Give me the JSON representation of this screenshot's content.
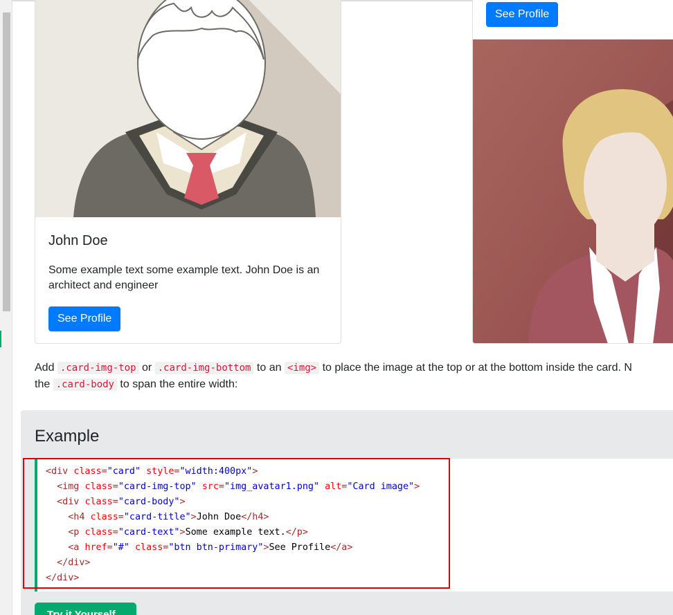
{
  "cards": [
    {
      "title": "John Doe",
      "text": "Some example text some example text. John Doe is an architect and engineer",
      "button_label": "See Profile"
    },
    {
      "button_label": "See Profile"
    }
  ],
  "description": {
    "part1": "Add ",
    "code1": ".card-img-top",
    "part2": " or ",
    "code2": ".card-img-bottom",
    "part3": " to an ",
    "code3": "<img>",
    "part4": " to place the image at the top or at the bottom inside the card. N",
    "line2_part1": "the ",
    "code4": ".card-body",
    "line2_part2": " to span the entire width:"
  },
  "example": {
    "title": "Example",
    "code_lines": [
      [
        [
          "t-tag",
          "<div "
        ],
        [
          "t-attr",
          "class="
        ],
        [
          "t-val",
          "\"card\""
        ],
        [
          "t-attr",
          " style="
        ],
        [
          "t-val",
          "\"width:400px\""
        ],
        [
          "t-tag",
          ">"
        ]
      ],
      [
        [
          "t-tag",
          "  <img "
        ],
        [
          "t-attr",
          "class="
        ],
        [
          "t-val",
          "\"card-img-top\""
        ],
        [
          "t-attr",
          " src="
        ],
        [
          "t-val",
          "\"img_avatar1.png\""
        ],
        [
          "t-attr",
          " alt="
        ],
        [
          "t-val",
          "\"Card image\""
        ],
        [
          "t-tag",
          ">"
        ]
      ],
      [
        [
          "t-tag",
          "  <div "
        ],
        [
          "t-attr",
          "class="
        ],
        [
          "t-val",
          "\"card-body\""
        ],
        [
          "t-tag",
          ">"
        ]
      ],
      [
        [
          "t-tag",
          "    <h4 "
        ],
        [
          "t-attr",
          "class="
        ],
        [
          "t-val",
          "\"card-title\""
        ],
        [
          "t-tag",
          ">"
        ],
        [
          "t-txt",
          "John Doe"
        ],
        [
          "t-tag",
          "</h4>"
        ]
      ],
      [
        [
          "t-tag",
          "    <p "
        ],
        [
          "t-attr",
          "class="
        ],
        [
          "t-val",
          "\"card-text\""
        ],
        [
          "t-tag",
          ">"
        ],
        [
          "t-txt",
          "Some example text."
        ],
        [
          "t-tag",
          "</p>"
        ]
      ],
      [
        [
          "t-tag",
          "    <a "
        ],
        [
          "t-attr",
          "href="
        ],
        [
          "t-val",
          "\"#\""
        ],
        [
          "t-attr",
          " class="
        ],
        [
          "t-val",
          "\"btn btn-primary\""
        ],
        [
          "t-tag",
          ">"
        ],
        [
          "t-txt",
          "See Profile"
        ],
        [
          "t-tag",
          "</a>"
        ]
      ],
      [
        [
          "t-tag",
          "  </div>"
        ]
      ],
      [
        [
          "t-tag",
          "</div>"
        ]
      ]
    ],
    "try_button_label": "Try it Yourself »"
  },
  "colors": {
    "primary": "#007bff",
    "accent_green": "#04aa6d",
    "highlight_red": "#e00000"
  }
}
